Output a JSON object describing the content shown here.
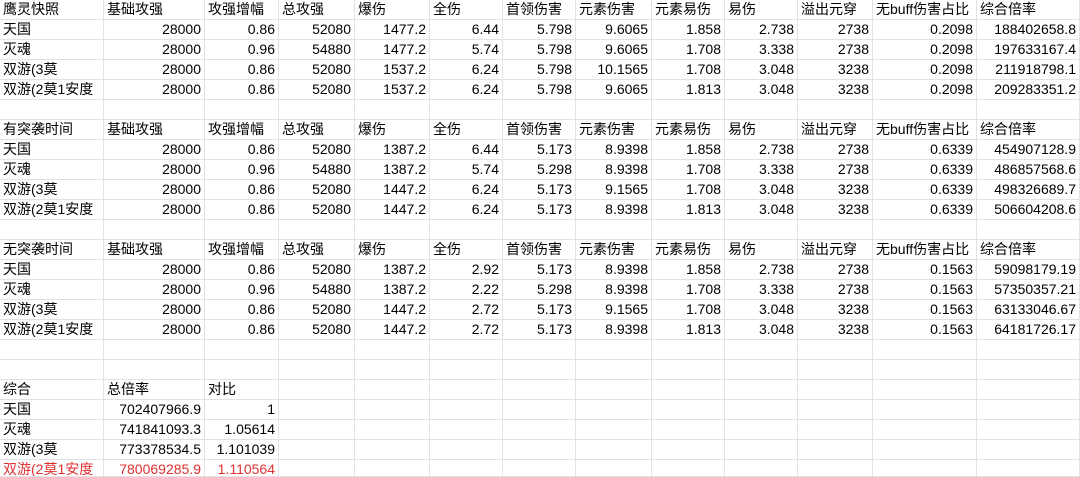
{
  "highlight_color": "#e03030",
  "grid_color": "#e2e2e2",
  "rows": [
    [
      "鹰灵快照",
      "基础攻强",
      "攻强增幅",
      "总攻强",
      "爆伤",
      "全伤",
      "首领伤害",
      "元素伤害",
      "元素易伤",
      "易伤",
      "溢出元穿",
      "无buff伤害占比",
      "综合倍率"
    ],
    [
      "天国",
      "28000",
      "0.86",
      "52080",
      "1477.2",
      "6.44",
      "5.798",
      "9.6065",
      "1.858",
      "2.738",
      "2738",
      "0.2098",
      "188402658.8"
    ],
    [
      "灭魂",
      "28000",
      "0.96",
      "54880",
      "1477.2",
      "5.74",
      "5.798",
      "9.6065",
      "1.708",
      "3.338",
      "2738",
      "0.2098",
      "197633167.4"
    ],
    [
      "双游(3莫",
      "28000",
      "0.86",
      "52080",
      "1537.2",
      "6.24",
      "5.798",
      "10.1565",
      "1.708",
      "3.048",
      "3238",
      "0.2098",
      "211918798.1"
    ],
    [
      "双游(2莫1安度",
      "28000",
      "0.86",
      "52080",
      "1537.2",
      "6.24",
      "5.798",
      "9.6065",
      "1.813",
      "3.048",
      "3238",
      "0.2098",
      "209283351.2"
    ],
    [
      "",
      "",
      "",
      "",
      "",
      "",
      "",
      "",
      "",
      "",
      "",
      "",
      ""
    ],
    [
      "有突袭时间",
      "基础攻强",
      "攻强增幅",
      "总攻强",
      "爆伤",
      "全伤",
      "首领伤害",
      "元素伤害",
      "元素易伤",
      "易伤",
      "溢出元穿",
      "无buff伤害占比",
      "综合倍率"
    ],
    [
      "天国",
      "28000",
      "0.86",
      "52080",
      "1387.2",
      "6.44",
      "5.173",
      "8.9398",
      "1.858",
      "2.738",
      "2738",
      "0.6339",
      "454907128.9"
    ],
    [
      "灭魂",
      "28000",
      "0.96",
      "54880",
      "1387.2",
      "5.74",
      "5.298",
      "8.9398",
      "1.708",
      "3.338",
      "2738",
      "0.6339",
      "486857568.6"
    ],
    [
      "双游(3莫",
      "28000",
      "0.86",
      "52080",
      "1447.2",
      "6.24",
      "5.173",
      "9.1565",
      "1.708",
      "3.048",
      "3238",
      "0.6339",
      "498326689.7"
    ],
    [
      "双游(2莫1安度",
      "28000",
      "0.86",
      "52080",
      "1447.2",
      "6.24",
      "5.173",
      "8.9398",
      "1.813",
      "3.048",
      "3238",
      "0.6339",
      "506604208.6"
    ],
    [
      "",
      "",
      "",
      "",
      "",
      "",
      "",
      "",
      "",
      "",
      "",
      "",
      ""
    ],
    [
      "无突袭时间",
      "基础攻强",
      "攻强增幅",
      "总攻强",
      "爆伤",
      "全伤",
      "首领伤害",
      "元素伤害",
      "元素易伤",
      "易伤",
      "溢出元穿",
      "无buff伤害占比",
      "综合倍率"
    ],
    [
      "天国",
      "28000",
      "0.86",
      "52080",
      "1387.2",
      "2.92",
      "5.173",
      "8.9398",
      "1.858",
      "2.738",
      "2738",
      "0.1563",
      "59098179.19"
    ],
    [
      "灭魂",
      "28000",
      "0.96",
      "54880",
      "1387.2",
      "2.22",
      "5.298",
      "8.9398",
      "1.708",
      "3.338",
      "2738",
      "0.1563",
      "57350357.21"
    ],
    [
      "双游(3莫",
      "28000",
      "0.86",
      "52080",
      "1447.2",
      "2.72",
      "5.173",
      "9.1565",
      "1.708",
      "3.048",
      "3238",
      "0.1563",
      "63133046.67"
    ],
    [
      "双游(2莫1安度",
      "28000",
      "0.86",
      "52080",
      "1447.2",
      "2.72",
      "5.173",
      "8.9398",
      "1.813",
      "3.048",
      "3238",
      "0.1563",
      "64181726.17"
    ],
    [
      "",
      "",
      "",
      "",
      "",
      "",
      "",
      "",
      "",
      "",
      "",
      "",
      ""
    ],
    [
      "",
      "",
      "",
      "",
      "",
      "",
      "",
      "",
      "",
      "",
      "",
      "",
      ""
    ],
    [
      "综合",
      "总倍率",
      "对比",
      "",
      "",
      "",
      "",
      "",
      "",
      "",
      "",
      "",
      ""
    ],
    [
      "天国",
      "702407966.9",
      "1",
      "",
      "",
      "",
      "",
      "",
      "",
      "",
      "",
      "",
      ""
    ],
    [
      "灭魂",
      "741841093.3",
      "1.05614",
      "",
      "",
      "",
      "",
      "",
      "",
      "",
      "",
      "",
      ""
    ],
    [
      "双游(3莫",
      "773378534.5",
      "1.101039",
      "",
      "",
      "",
      "",
      "",
      "",
      "",
      "",
      "",
      ""
    ],
    [
      "双游(2莫1安度",
      "780069285.9",
      "1.110564",
      "",
      "",
      "",
      "",
      "",
      "",
      "",
      "",
      "",
      ""
    ]
  ]
}
